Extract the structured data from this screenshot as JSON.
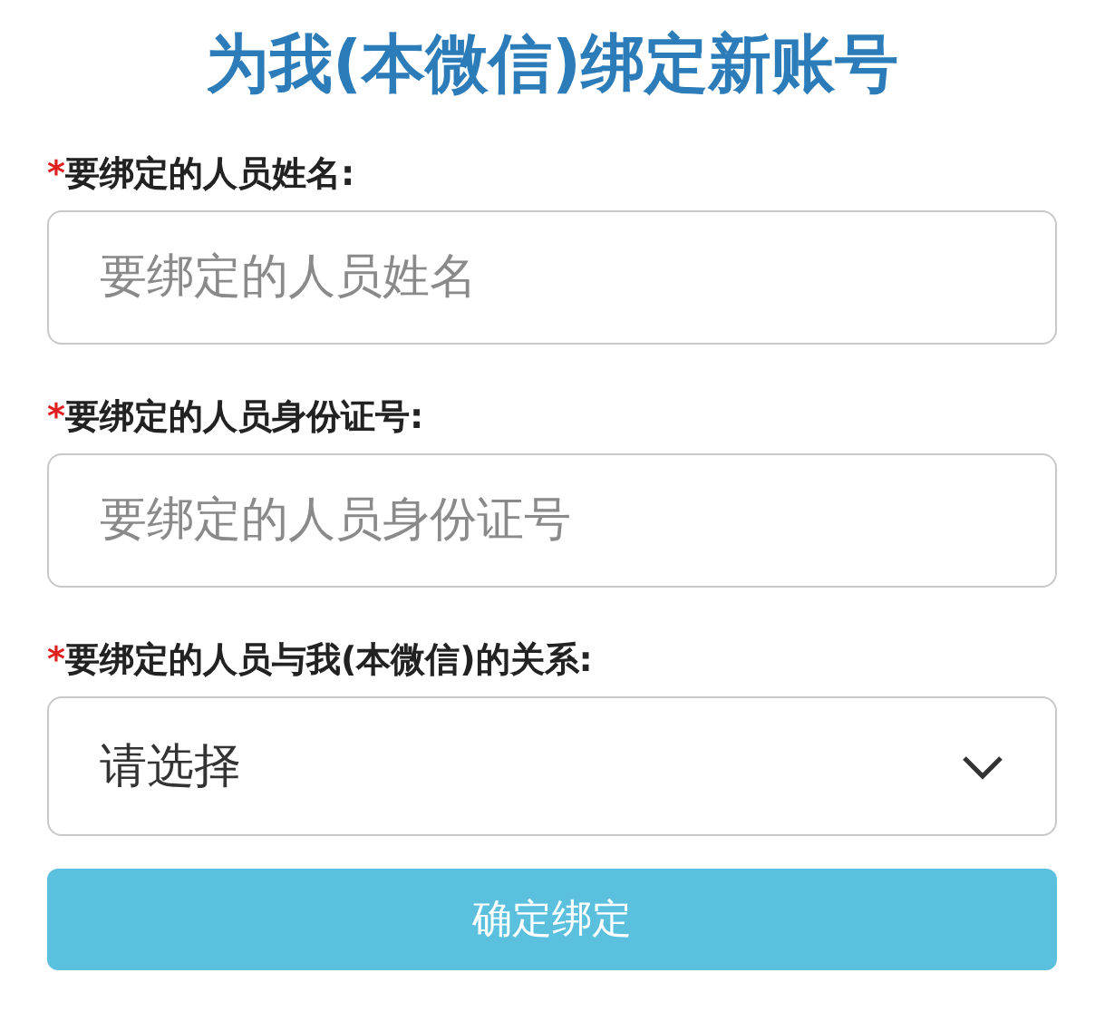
{
  "title": "为我(本微信)绑定新账号",
  "fields": [
    {
      "kind": "input",
      "required_mark": "*",
      "label": "要绑定的人员姓名:",
      "placeholder": "要绑定的人员姓名"
    },
    {
      "kind": "input",
      "required_mark": "*",
      "label": "要绑定的人员身份证号:",
      "placeholder": "要绑定的人员身份证号"
    },
    {
      "kind": "select",
      "required_mark": "*",
      "label": "要绑定的人员与我(本微信)的关系:",
      "value": "请选择"
    }
  ],
  "submit_button": "确定绑定"
}
